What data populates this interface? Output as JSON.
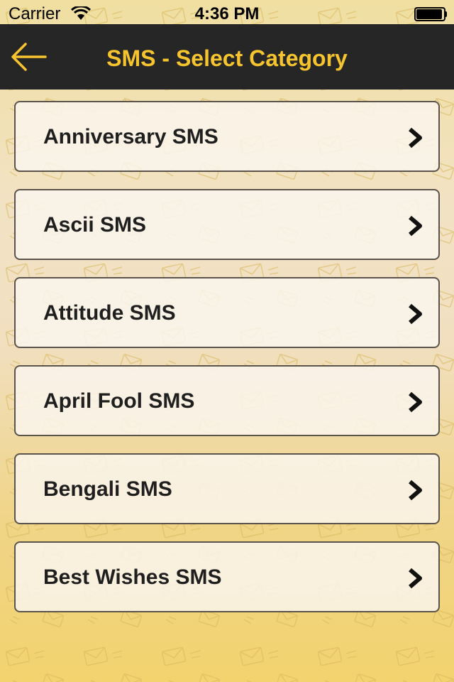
{
  "status_bar": {
    "carrier": "Carrier",
    "time": "4:36 PM",
    "wifi_icon": "wifi-icon",
    "battery_icon": "battery-icon"
  },
  "nav": {
    "title": "SMS - Select Category",
    "back_icon": "back-arrow-icon"
  },
  "colors": {
    "nav_background": "#262626",
    "title_color": "#f6c42e",
    "row_border": "#5a544c"
  },
  "categories": [
    {
      "label": "Anniversary SMS",
      "icon": "chevron-right-icon"
    },
    {
      "label": "Ascii SMS",
      "icon": "chevron-right-icon"
    },
    {
      "label": "Attitude SMS",
      "icon": "chevron-right-icon"
    },
    {
      "label": "April Fool SMS",
      "icon": "chevron-right-icon"
    },
    {
      "label": "Bengali SMS",
      "icon": "chevron-right-icon"
    },
    {
      "label": "Best Wishes SMS",
      "icon": "chevron-right-icon"
    }
  ]
}
